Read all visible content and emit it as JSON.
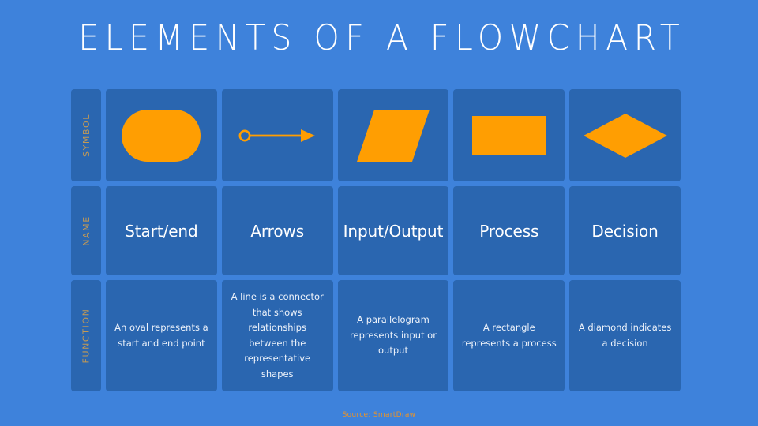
{
  "slide": {
    "title": "ELEMENTS OF A FLOWCHART",
    "source": "Source: SmartDraw",
    "colors": {
      "background": "#3e82db",
      "cell": "#2a66b0",
      "shape": "#ff9e02",
      "title_text": "#ffffff",
      "row_label_text": "#c49a54",
      "name_text": "#ffffff",
      "function_text": "#eef3fb",
      "source_text": "#e8932a"
    }
  },
  "rows": {
    "symbol_label": "SYMBOL",
    "name_label": "NAME",
    "function_label": "FUNCTION"
  },
  "columns": [
    {
      "symbol_icon": "rounded-oval-shape",
      "name": "Start/end",
      "function": "An oval represents a start and end point"
    },
    {
      "symbol_icon": "arrow-connector-shape",
      "name": "Arrows",
      "function": "A line is a connector that shows relationships between the representative shapes"
    },
    {
      "symbol_icon": "parallelogram-shape",
      "name": "Input/Output",
      "function": "A parallelogram represents input or output"
    },
    {
      "symbol_icon": "rectangle-shape",
      "name": "Process",
      "function": "A rectangle represents a process"
    },
    {
      "symbol_icon": "diamond-shape",
      "name": "Decision",
      "function": "A diamond indicates a decision"
    }
  ]
}
